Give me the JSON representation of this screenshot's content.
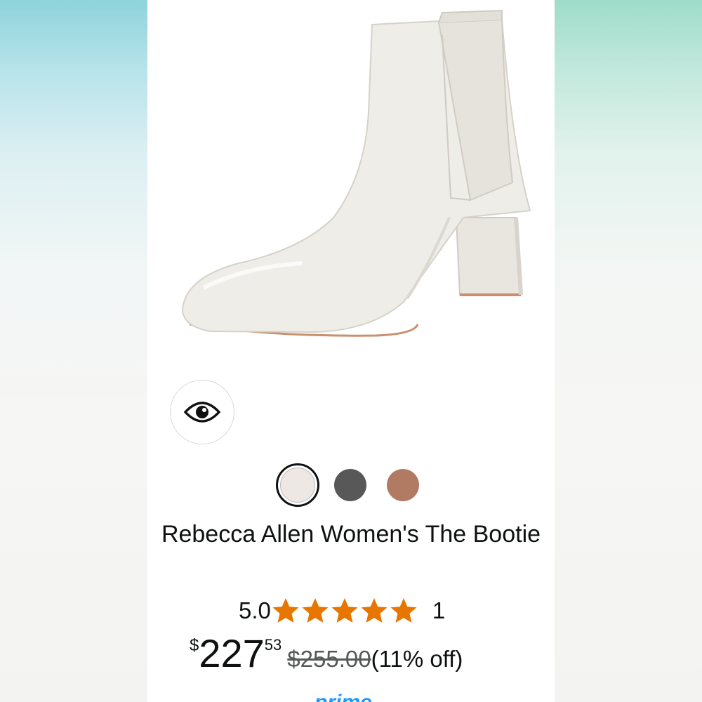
{
  "product": {
    "title": "Rebecca Allen Women's The Bootie",
    "image": "white-leather-ankle-bootie-photo"
  },
  "view_button": {
    "icon": "eye-icon"
  },
  "swatches": [
    {
      "color": "#ede8e4",
      "selected": true
    },
    {
      "color": "#585858",
      "selected": false
    },
    {
      "color": "#b07a63",
      "selected": false
    }
  ],
  "rating": {
    "value": "5.0",
    "stars": 5,
    "count": "1",
    "star_color": "#e77600"
  },
  "price": {
    "symbol": "$",
    "whole": "227",
    "fraction": "53",
    "list_price": "$255.00",
    "discount": "(11% off)"
  },
  "prime": {
    "label": "prime",
    "color": "#1a98ff"
  }
}
